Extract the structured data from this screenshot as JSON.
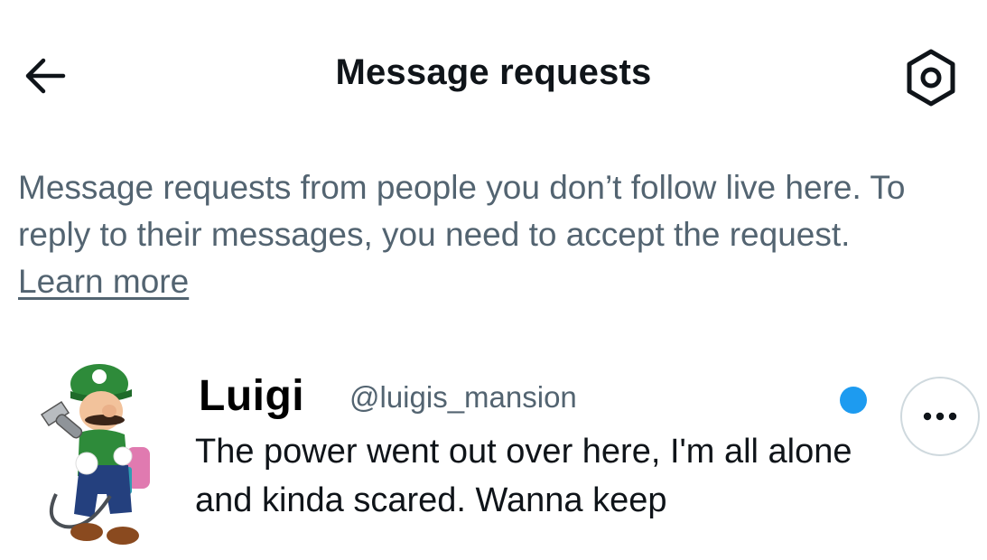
{
  "header": {
    "title": "Message requests",
    "back_icon": "arrow-left-icon",
    "settings_icon": "gear-icon"
  },
  "notice": {
    "text": "Message requests from people you don’t follow live here. To reply to their messages, you need to accept the request.",
    "link": "Learn more"
  },
  "requests": [
    {
      "name": "Luigi",
      "handle": "@luigis_mansion",
      "preview": "The power went out over here, I'm all alone and kinda scared. Wanna keep",
      "unread": true,
      "more_icon": "more-horizontal-icon"
    }
  ],
  "colors": {
    "text": "#0f1419",
    "secondary": "#536471",
    "accent": "#1d9bf0",
    "border": "#cfd9de"
  }
}
